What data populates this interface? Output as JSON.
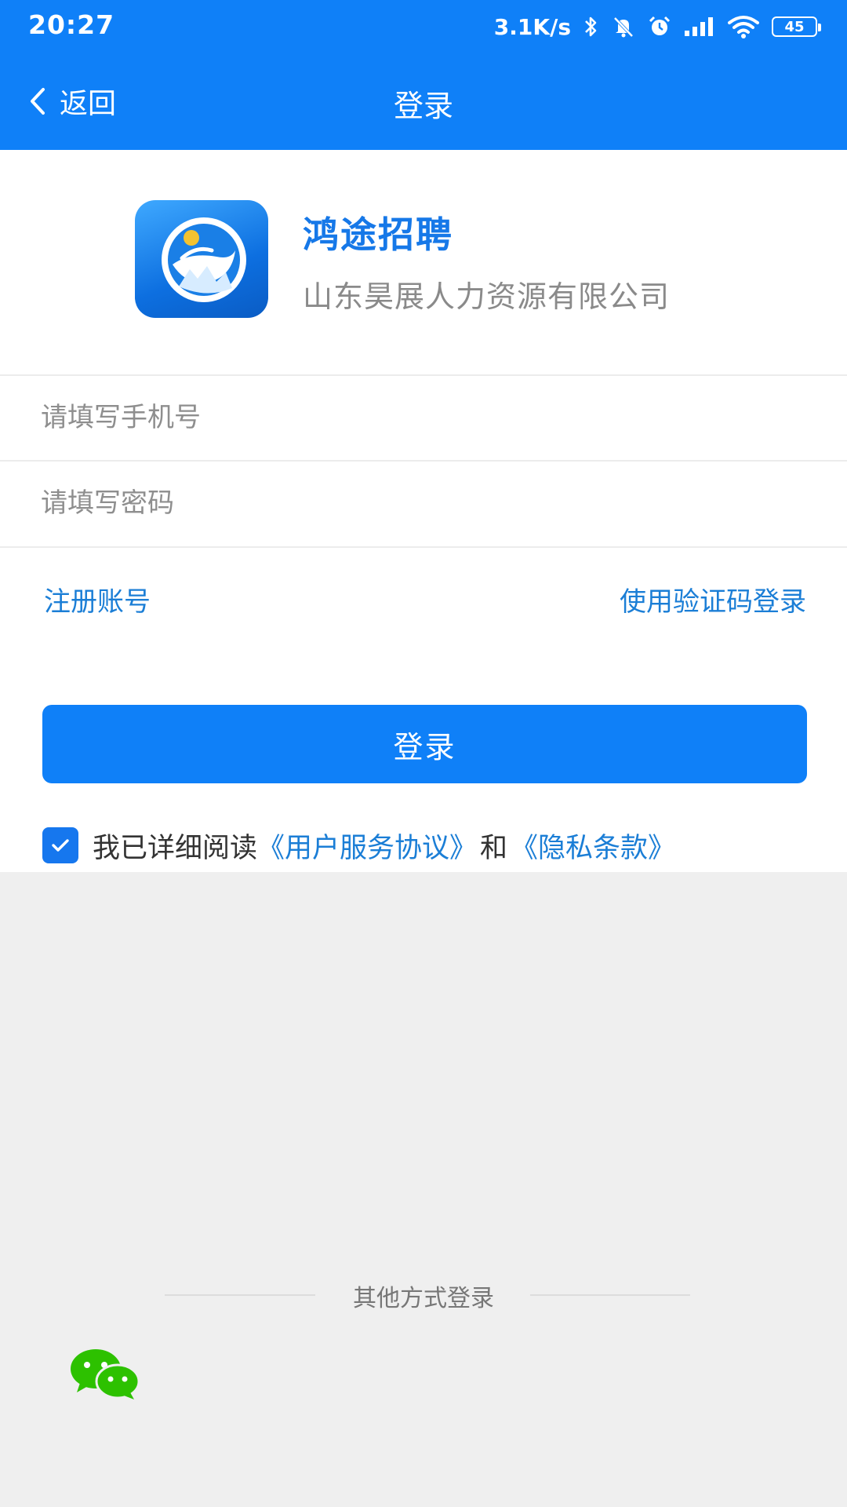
{
  "status_bar": {
    "time": "20:27",
    "net_speed": "3.1K/s",
    "battery": "45",
    "icons": [
      "bluetooth-icon",
      "mute-icon",
      "alarm-icon",
      "signal-icon",
      "wifi-icon",
      "battery-icon"
    ]
  },
  "nav": {
    "back_label": "返回",
    "title": "登录"
  },
  "brand": {
    "app_name": "鸿途招聘",
    "company": "山东昊展人力资源有限公司"
  },
  "form": {
    "phone_placeholder": "请填写手机号",
    "password_placeholder": "请填写密码",
    "register_link": "注册账号",
    "sms_login_link": "使用验证码登录",
    "submit_label": "登录"
  },
  "agreement": {
    "checked": true,
    "prefix": "我已详细阅读",
    "terms_link": "《用户服务协议》",
    "conjunction": "和",
    "privacy_link": "《隐私条款》"
  },
  "other_login": {
    "label": "其他方式登录",
    "methods": [
      "wechat-icon"
    ]
  },
  "colors": {
    "primary": "#0f80f8",
    "link": "#1b7ed6",
    "background": "#efefef",
    "wechat": "#2dc100"
  }
}
